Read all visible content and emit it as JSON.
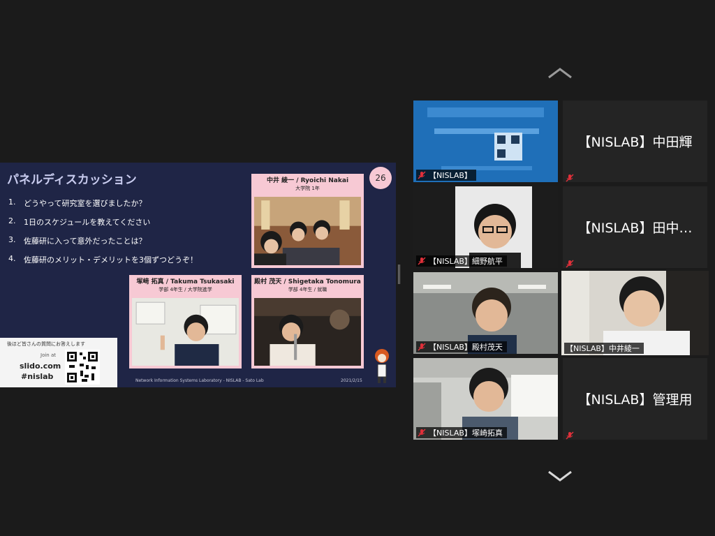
{
  "slide": {
    "title": "パネルディスカッション",
    "page_number": "26",
    "questions": [
      {
        "n": "1.",
        "text": "どうやって研究室を選びましたか？"
      },
      {
        "n": "2.",
        "text": "1日のスケジュールを教えてください"
      },
      {
        "n": "3.",
        "text": "佐藤研に入って意外だったことは？"
      },
      {
        "n": "4.",
        "text": "佐藤研のメリット・デメリットを3個ずつどうぞ！"
      }
    ],
    "cards": {
      "nakai": {
        "name": "中井 綾一 / Ryoichi Nakai",
        "sub": "大学院 1年"
      },
      "tsukasaki": {
        "name": "塚﨑 拓真 / Takuma Tsukasaki",
        "sub": "学部 4年生 / 大学院進学"
      },
      "tonomura": {
        "name": "殿村 茂天 / Shigetaka Tonomura",
        "sub": "学部 4年生 / 就職"
      }
    },
    "slido": {
      "caption": "後ほど皆さんの質問にお答えします",
      "join": "Join at",
      "url": "slido.com",
      "tag": "#nislab"
    },
    "footer": "Network Information Systems Laboratory - NISLAB - Sato Lab",
    "date": "2021/2/15"
  },
  "tiles": {
    "shared_label": "【NISLAB】",
    "nakata": "【NISLAB】中田輝",
    "hosono": "【NISLAB】細野航平",
    "tanaka": "【NISLAB】田中…",
    "tonomura": "【NISLAB】殿村茂天",
    "nakai": "【NISLAB】中井綾一",
    "tsukasaki": "【NISLAB】塚崎拓真",
    "admin": "【NISLAB】管理用"
  },
  "colors": {
    "active_border": "#9acd32",
    "slide_bg": "#1f2546",
    "card_pink": "#f7c9d4",
    "muted_mic": "#e0303a"
  },
  "icons": [
    "chevron-up-icon",
    "chevron-down-icon",
    "mic-muted-icon"
  ]
}
